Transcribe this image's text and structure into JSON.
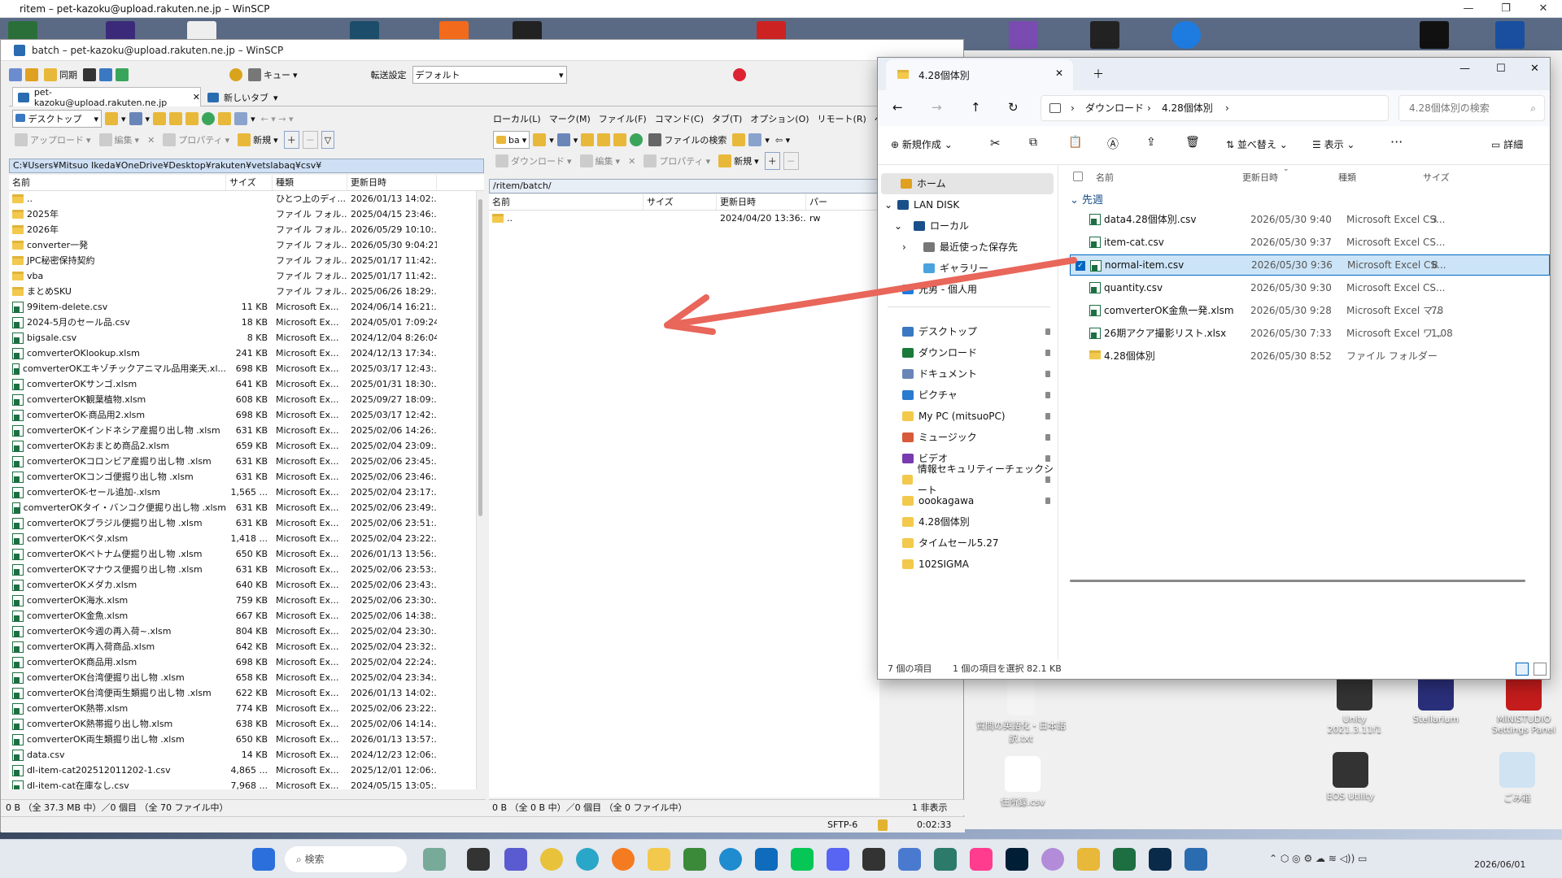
{
  "outer_window": {
    "title": "ritem – pet-kazoku@upload.rakuten.ne.jp – WinSCP"
  },
  "inner_window": {
    "title": "batch – pet-kazoku@upload.rakuten.ne.jp – WinSCP"
  },
  "session_tabs": {
    "active": "pet-kazoku@upload.rakuten.ne.jp",
    "new_tab": "新しいタブ"
  },
  "main_toolbar": {
    "sync": "同期",
    "queue": "キュー",
    "transfer_label": "転送設定",
    "transfer_value": "デフォルト"
  },
  "local_toolbar": {
    "drive": "デスクトップ",
    "upload": "アップロード",
    "edit": "編集",
    "properties": "プロパティ",
    "new": "新規"
  },
  "remote_menu": [
    "ローカル(L)",
    "マーク(M)",
    "ファイル(F)",
    "コマンド(C)",
    "タブ(T)",
    "オプション(O)",
    "リモート(R)",
    "ヘルプ(H)"
  ],
  "remote_toolbar": {
    "dir": "ba",
    "find": "ファイルの検索",
    "download": "ダウンロード",
    "edit": "編集",
    "properties": "プロパティ",
    "new": "新規"
  },
  "local_panel": {
    "path": "C:¥Users¥Mitsuo Ikeda¥OneDrive¥Desktop¥rakuten¥vetslabaq¥csv¥",
    "columns": [
      "名前",
      "サイズ",
      "種類",
      "更新日時"
    ],
    "rows": [
      {
        "name": "..",
        "size": "",
        "type": "ひとつ上のディ...",
        "date": "2026/01/13 14:02:...",
        "icon": "up"
      },
      {
        "name": "2025年",
        "size": "",
        "type": "ファイル フォル...",
        "date": "2025/04/15 23:46:...",
        "icon": "folder"
      },
      {
        "name": "2026年",
        "size": "",
        "type": "ファイル フォル...",
        "date": "2026/05/29 10:10:...",
        "icon": "folder"
      },
      {
        "name": "converter一発",
        "size": "",
        "type": "ファイル フォル...",
        "date": "2026/05/30 9:04:21",
        "icon": "folder"
      },
      {
        "name": "JPC秘密保持契約",
        "size": "",
        "type": "ファイル フォル...",
        "date": "2025/01/17 11:42:...",
        "icon": "folder"
      },
      {
        "name": "vba",
        "size": "",
        "type": "ファイル フォル...",
        "date": "2025/01/17 11:42:...",
        "icon": "folder"
      },
      {
        "name": "まとめSKU",
        "size": "",
        "type": "ファイル フォル...",
        "date": "2025/06/26 18:29:...",
        "icon": "folder"
      },
      {
        "name": "99item-delete.csv",
        "size": "11 KB",
        "type": "Microsoft Ex...",
        "date": "2024/06/14 16:21:...",
        "icon": "xl"
      },
      {
        "name": "2024-5月のセール品.csv",
        "size": "18 KB",
        "type": "Microsoft Ex...",
        "date": "2024/05/01 7:09:24",
        "icon": "xl"
      },
      {
        "name": "bigsale.csv",
        "size": "8 KB",
        "type": "Microsoft Ex...",
        "date": "2024/12/04 8:26:04",
        "icon": "xl"
      },
      {
        "name": "comverterOKlookup.xlsm",
        "size": "241 KB",
        "type": "Microsoft Ex...",
        "date": "2024/12/13 17:34:...",
        "icon": "xl"
      },
      {
        "name": "comverterOKエキゾチックアニマル品用楽天.xl...",
        "size": "698 KB",
        "type": "Microsoft Ex...",
        "date": "2025/03/17 12:43:...",
        "icon": "xl"
      },
      {
        "name": "comverterOKサンゴ.xlsm",
        "size": "641 KB",
        "type": "Microsoft Ex...",
        "date": "2025/01/31 18:30:...",
        "icon": "xl"
      },
      {
        "name": "comverterOK観葉植物.xlsm",
        "size": "608 KB",
        "type": "Microsoft Ex...",
        "date": "2025/09/27 18:09:...",
        "icon": "xl"
      },
      {
        "name": "comverterOK-商品用2.xlsm",
        "size": "698 KB",
        "type": "Microsoft Ex...",
        "date": "2025/03/17 12:42:...",
        "icon": "xl"
      },
      {
        "name": "comverterOKインドネシア産掘り出し物 .xlsm",
        "size": "631 KB",
        "type": "Microsoft Ex...",
        "date": "2025/02/06 14:26:...",
        "icon": "xl"
      },
      {
        "name": "comverterOKおまとめ商品2.xlsm",
        "size": "659 KB",
        "type": "Microsoft Ex...",
        "date": "2025/02/04 23:09:...",
        "icon": "xl"
      },
      {
        "name": "comverterOKコロンビア産掘り出し物 .xlsm",
        "size": "631 KB",
        "type": "Microsoft Ex...",
        "date": "2025/02/06 23:45:...",
        "icon": "xl"
      },
      {
        "name": "comverterOKコンゴ便掘り出し物 .xlsm",
        "size": "631 KB",
        "type": "Microsoft Ex...",
        "date": "2025/02/06 23:46:...",
        "icon": "xl"
      },
      {
        "name": "comverterOK-セール追加-.xlsm",
        "size": "1,565 ...",
        "type": "Microsoft Ex...",
        "date": "2025/02/04 23:17:...",
        "icon": "xl"
      },
      {
        "name": "comverterOKタイ・バンコク便掘り出し物 .xlsm",
        "size": "631 KB",
        "type": "Microsoft Ex...",
        "date": "2025/02/06 23:49:...",
        "icon": "xl"
      },
      {
        "name": "comverterOKブラジル便掘り出し物 .xlsm",
        "size": "631 KB",
        "type": "Microsoft Ex...",
        "date": "2025/02/06 23:51:...",
        "icon": "xl"
      },
      {
        "name": "comverterOKベタ.xlsm",
        "size": "1,418 ...",
        "type": "Microsoft Ex...",
        "date": "2025/02/04 23:22:...",
        "icon": "xl"
      },
      {
        "name": "comverterOKベトナム便掘り出し物 .xlsm",
        "size": "650 KB",
        "type": "Microsoft Ex...",
        "date": "2026/01/13 13:56:...",
        "icon": "xl"
      },
      {
        "name": "comverterOKマナウス便掘り出し物 .xlsm",
        "size": "631 KB",
        "type": "Microsoft Ex...",
        "date": "2025/02/06 23:53:...",
        "icon": "xl"
      },
      {
        "name": "comverterOKメダカ.xlsm",
        "size": "640 KB",
        "type": "Microsoft Ex...",
        "date": "2025/02/06 23:43:...",
        "icon": "xl"
      },
      {
        "name": "comverterOK海水.xlsm",
        "size": "759 KB",
        "type": "Microsoft Ex...",
        "date": "2025/02/06 23:30:...",
        "icon": "xl"
      },
      {
        "name": "comverterOK金魚.xlsm",
        "size": "667 KB",
        "type": "Microsoft Ex...",
        "date": "2025/02/06 14:38:...",
        "icon": "xl"
      },
      {
        "name": "comverterOK今週の再入荷~.xlsm",
        "size": "804 KB",
        "type": "Microsoft Ex...",
        "date": "2025/02/04 23:30:...",
        "icon": "xl"
      },
      {
        "name": "comverterOK再入荷商品.xlsm",
        "size": "642 KB",
        "type": "Microsoft Ex...",
        "date": "2025/02/04 23:32:...",
        "icon": "xl"
      },
      {
        "name": "comverterOK商品用.xlsm",
        "size": "698 KB",
        "type": "Microsoft Ex...",
        "date": "2025/02/04 22:24:...",
        "icon": "xl"
      },
      {
        "name": "comverterOK台湾便掘り出し物 .xlsm",
        "size": "658 KB",
        "type": "Microsoft Ex...",
        "date": "2025/02/04 23:34:...",
        "icon": "xl"
      },
      {
        "name": "comverterOK台湾便両生類掘り出し物 .xlsm",
        "size": "622 KB",
        "type": "Microsoft Ex...",
        "date": "2026/01/13 14:02:...",
        "icon": "xl"
      },
      {
        "name": "comverterOK熱帯.xlsm",
        "size": "774 KB",
        "type": "Microsoft Ex...",
        "date": "2025/02/06 23:22:...",
        "icon": "xl"
      },
      {
        "name": "comverterOK熱帯掘り出し物.xlsm",
        "size": "638 KB",
        "type": "Microsoft Ex...",
        "date": "2025/02/06 14:14:...",
        "icon": "xl"
      },
      {
        "name": "comverterOK両生類掘り出し物 .xlsm",
        "size": "650 KB",
        "type": "Microsoft Ex...",
        "date": "2026/01/13 13:57:...",
        "icon": "xl"
      },
      {
        "name": "data.csv",
        "size": "14 KB",
        "type": "Microsoft Ex...",
        "date": "2024/12/23 12:06:...",
        "icon": "xl"
      },
      {
        "name": "dl-item-cat202512011202-1.csv",
        "size": "4,865 ...",
        "type": "Microsoft Ex...",
        "date": "2025/12/01 12:06:...",
        "icon": "xl"
      },
      {
        "name": "dl-item-cat在庫なし.csv",
        "size": "7,968 ...",
        "type": "Microsoft Ex...",
        "date": "2024/05/15 13:05:...",
        "icon": "xl"
      }
    ],
    "status": "0 B （全 37.3 MB 中）／0 個目 （全 70 ファイル中）"
  },
  "remote_panel": {
    "path": "/ritem/batch/",
    "columns": [
      "名前",
      "サイズ",
      "更新日時",
      "パー"
    ],
    "rows": [
      {
        "name": "..",
        "size": "",
        "date": "2024/04/20 13:36:...",
        "perm": "rw"
      }
    ],
    "status": "0 B （全 0 B 中）／0 個目 （全 0 ファイル中）",
    "hidden": "1 非表示"
  },
  "bottom_status": {
    "protocol": "SFTP-6",
    "time": "0:02:33"
  },
  "explorer": {
    "tab_title": "4.28個体別",
    "breadcrumb": [
      "ダウンロード",
      "4.28個体別"
    ],
    "search_placeholder": "4.28個体別の検索",
    "cmd": {
      "new": "新規作成",
      "sort": "並べ替え",
      "view": "表示",
      "details": "詳細"
    },
    "nav": [
      {
        "label": "ホーム",
        "icon": "home-icon"
      },
      {
        "label": "LAN DISK",
        "icon": "drive-icon"
      },
      {
        "label": "ローカル",
        "icon": "drive-icon"
      },
      {
        "label": "最近使った保存先",
        "icon": "clock-icon"
      },
      {
        "label": "ギャラリー",
        "icon": "gallery-icon"
      },
      {
        "label": "光男 - 個人用",
        "icon": "cloud-icon"
      },
      {
        "label": "デスクトップ",
        "icon": "desktop-icon"
      },
      {
        "label": "ダウンロード",
        "icon": "download-icon"
      },
      {
        "label": "ドキュメント",
        "icon": "document-icon"
      },
      {
        "label": "ピクチャ",
        "icon": "picture-icon"
      },
      {
        "label": "My PC (mitsuoPC)",
        "icon": "folder-icon"
      },
      {
        "label": "ミュージック",
        "icon": "music-icon"
      },
      {
        "label": "ビデオ",
        "icon": "video-icon"
      },
      {
        "label": "情報セキュリティーチェックシート",
        "icon": "folder-icon"
      },
      {
        "label": "oookagawa",
        "icon": "folder-icon"
      },
      {
        "label": "4.28個体別",
        "icon": "folder-icon"
      },
      {
        "label": "タイムセール5.27",
        "icon": "folder-icon"
      },
      {
        "label": "102SIGMA",
        "icon": "folder-icon"
      }
    ],
    "columns": [
      "名前",
      "更新日時",
      "種類",
      "サイズ"
    ],
    "group": "先週",
    "files": [
      {
        "name": "data4.28個体別.csv",
        "date": "2026/05/30 9:40",
        "type": "Microsoft Excel CS...",
        "size": "3"
      },
      {
        "name": "item-cat.csv",
        "date": "2026/05/30 9:37",
        "type": "Microsoft Excel CS...",
        "size": ""
      },
      {
        "name": "normal-item.csv",
        "date": "2026/05/30 9:36",
        "type": "Microsoft Excel CS...",
        "size": "8"
      },
      {
        "name": "quantity.csv",
        "date": "2026/05/30 9:30",
        "type": "Microsoft Excel CS...",
        "size": ""
      },
      {
        "name": "comverterOK金魚一発.xlsm",
        "date": "2026/05/30 9:28",
        "type": "Microsoft Excel マ...",
        "size": "78"
      },
      {
        "name": "26期アクア撮影リスト.xlsx",
        "date": "2026/05/30 7:33",
        "type": "Microsoft Excel ワ...",
        "size": "1,08"
      },
      {
        "name": "4.28個体別",
        "date": "2026/05/30 8:52",
        "type": "ファイル フォルダー",
        "size": ""
      }
    ],
    "selected_index": 2,
    "status_count": "7 個の項目",
    "status_selected": "1 個の項目を選択 82.1 KB"
  },
  "desktop_icons": [
    {
      "label": "Unity 2021.3.11f1"
    },
    {
      "label": "Stellarium"
    },
    {
      "label": "MINISTUDIO Settings Panel"
    },
    {
      "label": "EOS Utility"
    },
    {
      "label": "ごみ箱"
    },
    {
      "label": "住所録.csv"
    },
    {
      "label": "質問の英語化・日本語訳.txt"
    }
  ],
  "taskbar": {
    "search": "検索",
    "clock_date": "2026/06/01"
  },
  "colors": {
    "winscp_path": "#cfe0f5",
    "selection": "#cce4f7",
    "accent": "#0067c0",
    "arrow": "#e8665a"
  }
}
